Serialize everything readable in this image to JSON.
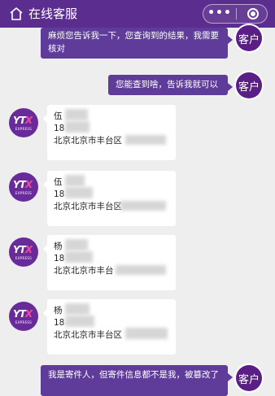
{
  "header": {
    "title": "在线客服",
    "more_label": "•••"
  },
  "user_avatar_label": "客户",
  "messages_out": [
    {
      "text": "麻烦您告诉我一下，您查询到的结果，我需要核对"
    },
    {
      "text": "您能查到啥，告诉我就可以"
    },
    {
      "text": "我是寄件人，但寄件信息都不是我，被篡改了"
    }
  ],
  "bot": {
    "logo_main": "YT",
    "logo_accent": "X",
    "logo_sub": "EXPRESS"
  },
  "cards": [
    {
      "name": "伍",
      "phone": "18",
      "address": "北京北京市丰台区"
    },
    {
      "name": "伍",
      "phone": "18",
      "address": "北京北京市丰台区"
    },
    {
      "name": "杨",
      "phone": "18",
      "address": "北京北京市丰台"
    },
    {
      "name": "杨",
      "phone": "18",
      "address": "北京北京市丰台区"
    }
  ]
}
